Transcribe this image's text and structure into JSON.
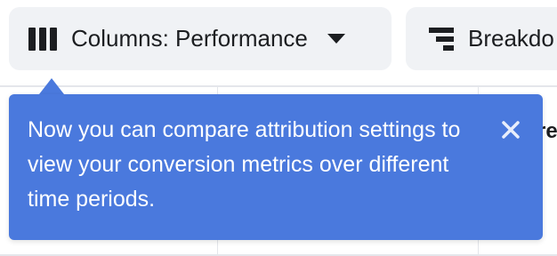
{
  "toolbar": {
    "columns_button": {
      "label": "Columns: Performance",
      "icon": "columns-icon",
      "caret_icon": "caret-down-icon"
    },
    "breakdown_button": {
      "label": "Breakdo",
      "icon": "breakdown-icon"
    }
  },
  "table": {
    "peek_header_text": "re"
  },
  "tooltip": {
    "text": "Now you can compare attribution settings to view your conversion metrics over different time periods.",
    "close_icon": "close-icon"
  },
  "colors": {
    "tooltip_bg": "#4a79dd",
    "button_bg": "#f0f2f5",
    "text": "#1c1e21"
  }
}
